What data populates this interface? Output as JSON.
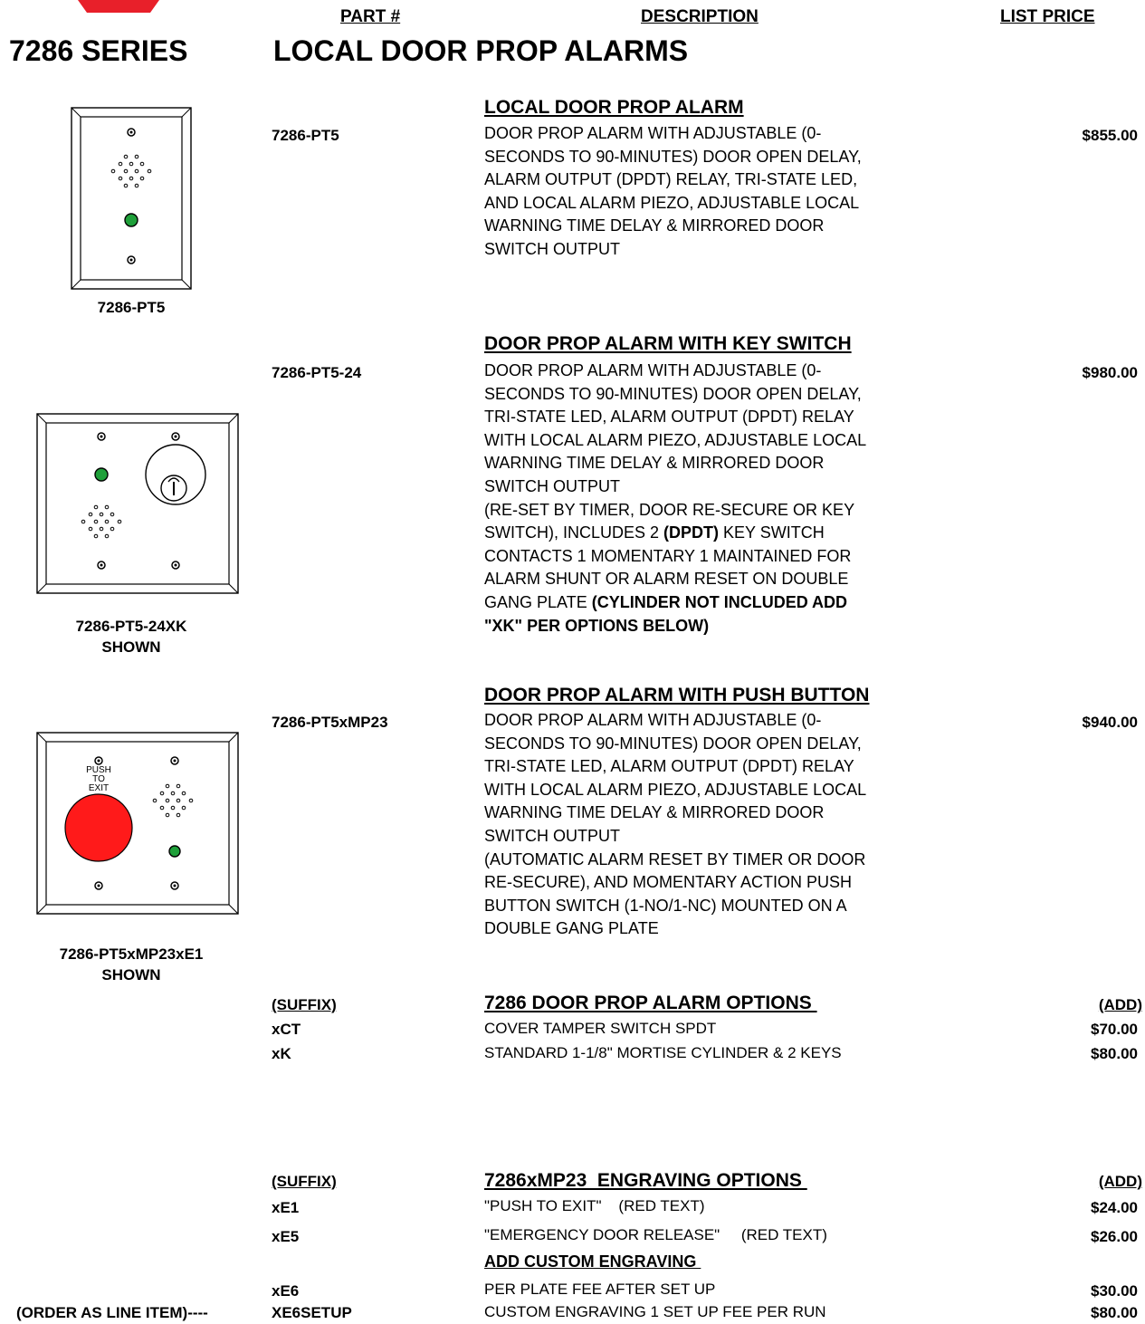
{
  "header": {
    "part_label": "PART #",
    "desc_label": "DESCRIPTION",
    "price_label": "LIST PRICE",
    "series": "7286 SERIES",
    "series_title": "LOCAL DOOR PROP ALARMS"
  },
  "products": [
    {
      "heading": "LOCAL DOOR PROP ALARM",
      "part": "7286-PT5",
      "price": "$855.00",
      "lines": [
        "DOOR PROP ALARM WITH ADJUSTABLE (0-",
        "SECONDS TO 90-MINUTES) DOOR OPEN DELAY,",
        "ALARM OUTPUT (DPDT) RELAY, TRI-STATE LED,",
        "AND LOCAL ALARM PIEZO, ADJUSTABLE LOCAL",
        "WARNING TIME DELAY & MIRRORED DOOR",
        "SWITCH OUTPUT"
      ],
      "caption": [
        "7286-PT5"
      ]
    },
    {
      "heading": "DOOR PROP ALARM WITH KEY SWITCH",
      "part": "7286-PT5-24",
      "price": "$980.00",
      "lines": [
        "DOOR PROP ALARM WITH ADJUSTABLE (0-",
        "SECONDS TO 90-MINUTES) DOOR OPEN DELAY,",
        "TRI-STATE LED, ALARM OUTPUT (DPDT) RELAY",
        "WITH LOCAL ALARM PIEZO, ADJUSTABLE LOCAL",
        "WARNING TIME DELAY & MIRRORED DOOR",
        "SWITCH OUTPUT",
        "(RE-SET BY TIMER, DOOR RE-SECURE OR KEY"
      ],
      "line8_a": "SWITCH), INCLUDES 2 ",
      "line8_b": "(DPDT)",
      "line8_c": " KEY SWITCH",
      "line9": "CONTACTS  1 MOMENTARY 1 MAINTAINED FOR",
      "line10": "ALARM SHUNT OR ALARM RESET ON DOUBLE",
      "line11_a": "GANG PLATE  ",
      "line11_b": "(CYLINDER NOT INCLUDED ADD",
      "line12": "\"XK\" PER OPTIONS BELOW)",
      "caption": [
        "7286-PT5-24XK",
        "SHOWN"
      ]
    },
    {
      "heading": "DOOR PROP ALARM WITH PUSH BUTTON",
      "part": "7286-PT5xMP23",
      "price": "$940.00",
      "lines": [
        "DOOR PROP ALARM WITH ADJUSTABLE (0-",
        "SECONDS TO 90-MINUTES) DOOR OPEN DELAY,",
        "TRI-STATE LED, ALARM OUTPUT (DPDT) RELAY",
        "WITH LOCAL ALARM PIEZO, ADJUSTABLE LOCAL",
        "WARNING TIME DELAY & MIRRORED DOOR",
        "SWITCH OUTPUT",
        "(AUTOMATIC ALARM RESET BY TIMER OR DOOR",
        "RE-SECURE), AND MOMENTARY ACTION PUSH",
        "BUTTON SWITCH (1-NO/1-NC) MOUNTED ON A",
        "DOUBLE GANG PLATE"
      ],
      "caption": [
        "7286-PT5xMP23xE1",
        "SHOWN"
      ],
      "plate_text": [
        "PUSH",
        "TO",
        "EXIT"
      ]
    }
  ],
  "options1": {
    "suffix_label": "(SUFFIX)",
    "heading": "7286 DOOR PROP ALARM OPTIONS ",
    "add_label": "(ADD)",
    "rows": [
      {
        "code": "xCT",
        "desc": "COVER TAMPER SWITCH SPDT",
        "price": "$70.00"
      },
      {
        "code": "xK",
        "desc": "STANDARD 1-1/8\" MORTISE CYLINDER & 2 KEYS",
        "price": "$80.00"
      }
    ]
  },
  "options2": {
    "suffix_label": "(SUFFIX)",
    "heading": "7286xMP23  ENGRAVING OPTIONS ",
    "add_label": "(ADD)",
    "rows": [
      {
        "code": "xE1",
        "desc": "\"PUSH TO EXIT\"    (RED TEXT)",
        "price": "$24.00"
      },
      {
        "code": "xE5",
        "desc": "\"EMERGENCY DOOR RELEASE\"     (RED TEXT)",
        "price": "$26.00"
      }
    ],
    "custom_heading": "ADD CUSTOM ENGRAVING ",
    "custom_rows": [
      {
        "code": "xE6",
        "desc": "PER PLATE FEE AFTER SET UP",
        "price": "$30.00"
      },
      {
        "prefix": "(ORDER AS LINE ITEM)----",
        "code": "XE6SETUP",
        "desc": "CUSTOM ENGRAVING 1 SET UP FEE PER RUN",
        "price": "$80.00"
      }
    ]
  },
  "colors": {
    "logo_red": "#e8202a",
    "led_green": "#1fa03a",
    "button_red": "#ff1a1a"
  },
  "icons": [
    "logo-mark",
    "single-gang-plate",
    "double-gang-key-plate",
    "double-gang-pushbutton-plate"
  ]
}
